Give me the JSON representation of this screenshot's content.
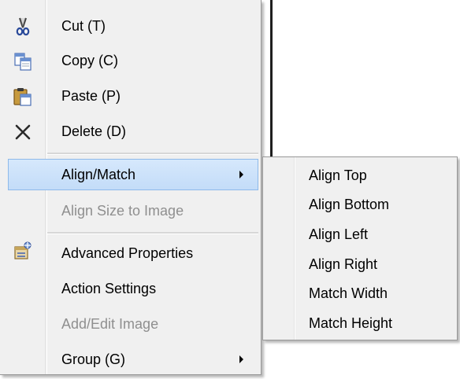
{
  "context_menu": {
    "items": [
      {
        "label": "Cut (T)",
        "icon": "scissors-icon"
      },
      {
        "label": "Copy (C)",
        "icon": "copy-icon"
      },
      {
        "label": "Paste (P)",
        "icon": "paste-icon"
      },
      {
        "label": "Delete (D)",
        "icon": "delete-x-icon"
      },
      {
        "label": "Align/Match",
        "has_submenu": true,
        "highlighted": true
      },
      {
        "label": "Align Size to Image",
        "disabled": true
      },
      {
        "label": "Advanced Properties",
        "icon": "properties-icon"
      },
      {
        "label": "Action Settings"
      },
      {
        "label": "Add/Edit Image",
        "disabled": true
      },
      {
        "label": "Group (G)",
        "has_submenu": true
      }
    ]
  },
  "submenu": {
    "items": [
      {
        "label": "Align Top"
      },
      {
        "label": "Align Bottom"
      },
      {
        "label": "Align Left"
      },
      {
        "label": "Align Right"
      },
      {
        "label": "Match Width"
      },
      {
        "label": "Match Height"
      }
    ]
  },
  "colors": {
    "highlight_bg": "#cde2fa",
    "highlight_border": "#8ebaea",
    "menu_bg": "#f0f0f0",
    "disabled_text": "#8f8f8f"
  }
}
